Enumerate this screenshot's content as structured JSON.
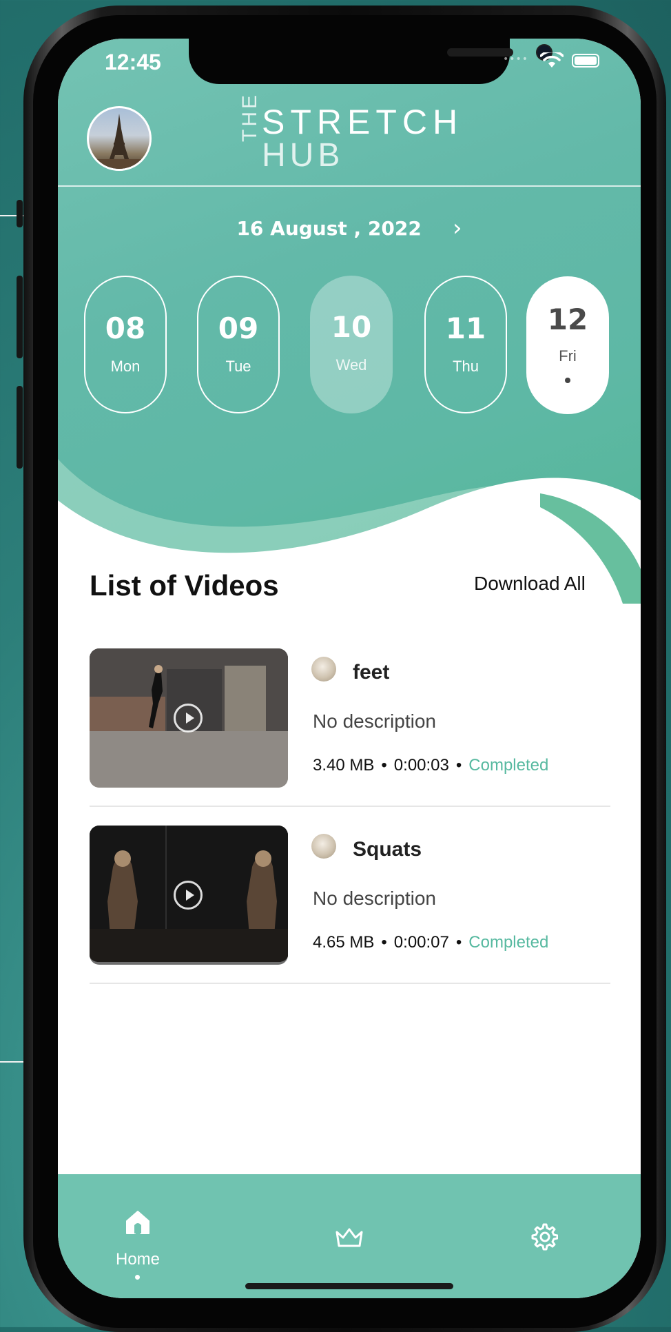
{
  "status_bar": {
    "time": "12:45"
  },
  "header": {
    "logo_the": "THE",
    "logo_stretch": "STRETCH",
    "logo_hub": "HUB"
  },
  "date_selector": {
    "current_date": "16 August , 2022",
    "next_icon": "chevron-right-icon",
    "days": [
      {
        "number": "08",
        "name": "Mon",
        "state": "default"
      },
      {
        "number": "09",
        "name": "Tue",
        "state": "default"
      },
      {
        "number": "10",
        "name": "Wed",
        "state": "highlight"
      },
      {
        "number": "11",
        "name": "Thu",
        "state": "default"
      },
      {
        "number": "12",
        "name": "Fri",
        "state": "selected"
      }
    ]
  },
  "videos_section": {
    "title": "List of Videos",
    "download_all": "Download All",
    "items": [
      {
        "title": "feet",
        "description": "No description",
        "size": "3.40 MB",
        "duration": "0:00:03",
        "status": "Completed"
      },
      {
        "title": "Squats",
        "description": "No description",
        "size": "4.65 MB",
        "duration": "0:00:07",
        "status": "Completed"
      }
    ],
    "separator": "•"
  },
  "tab_bar": {
    "items": [
      {
        "label": "Home",
        "icon": "home-icon",
        "active": true
      },
      {
        "label": "",
        "icon": "crown-icon",
        "active": false
      },
      {
        "label": "",
        "icon": "gear-icon",
        "active": false
      }
    ]
  },
  "colors": {
    "brand_teal": "#63b9a9",
    "status_completed": "#57b9a0",
    "tabbar": "#70c3b0"
  }
}
